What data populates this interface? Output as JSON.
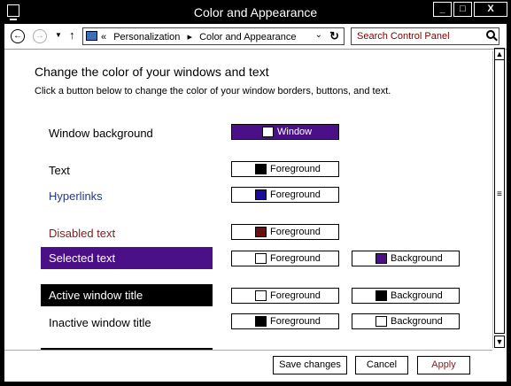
{
  "window": {
    "title": "Color and Appearance",
    "controls": {
      "minimize": "_",
      "maximize": "□",
      "close": "X"
    }
  },
  "addressbar": {
    "back_icon": "back-arrow-icon",
    "forward_icon": "forward-arrow-icon",
    "history_icon": "chevron-down-icon",
    "up_icon": "up-arrow-icon",
    "overflow": "«",
    "breadcrumbs": [
      "Personalization",
      "Color and Appearance"
    ],
    "separator": "▸",
    "dropdown": "⌄",
    "refresh": "↻",
    "search_placeholder": "Search Control Panel"
  },
  "content": {
    "heading": "Change the color of your windows and text",
    "subheading": "Click a button below to change the color of your window borders, buttons, and text.",
    "items": {
      "window_background": {
        "label": "Window background",
        "primary": {
          "label": "Window",
          "swatch": "#ffffff",
          "button_bg": "#4b0f87",
          "button_fg": "#ffffff"
        }
      },
      "text": {
        "label": "Text",
        "primary": {
          "label": "Foreground",
          "swatch": "#000000"
        }
      },
      "hyperlinks": {
        "label": "Hyperlinks",
        "label_color": "#1f3a8f",
        "primary": {
          "label": "Foreground",
          "swatch": "#1a0a9e"
        }
      },
      "disabled_text": {
        "label": "Disabled text",
        "label_color": "#7a2020",
        "primary": {
          "label": "Foreground",
          "swatch": "#6a0f0f"
        }
      },
      "selected_text": {
        "label": "Selected text",
        "label_bg": "#4b0f87",
        "label_color": "#ffffff",
        "primary": {
          "label": "Foreground",
          "swatch": "#ffffff"
        },
        "secondary": {
          "label": "Background",
          "swatch": "#4b0f87"
        }
      },
      "active_window_title": {
        "label": "Active window title",
        "label_bg": "#000000",
        "label_color": "#ffffff",
        "primary": {
          "label": "Foreground",
          "swatch": "#ffffff"
        },
        "secondary": {
          "label": "Background",
          "swatch": "#000000"
        }
      },
      "inactive_window_title": {
        "label": "Inactive window title",
        "primary": {
          "label": "Foreground",
          "swatch": "#000000"
        },
        "secondary": {
          "label": "Background",
          "swatch": "#ffffff"
        }
      }
    }
  },
  "scrollbar": {
    "up": "▲",
    "down": "▼",
    "grip": "≡"
  },
  "footer": {
    "save": "Save changes",
    "cancel": "Cancel",
    "apply": "Apply",
    "apply_color": "#8b1a1a"
  },
  "colors": {
    "accent_purple": "#4b0f87",
    "hyperlink": "#1f3a8f",
    "disabled": "#7a2020",
    "search_text": "#800000"
  }
}
